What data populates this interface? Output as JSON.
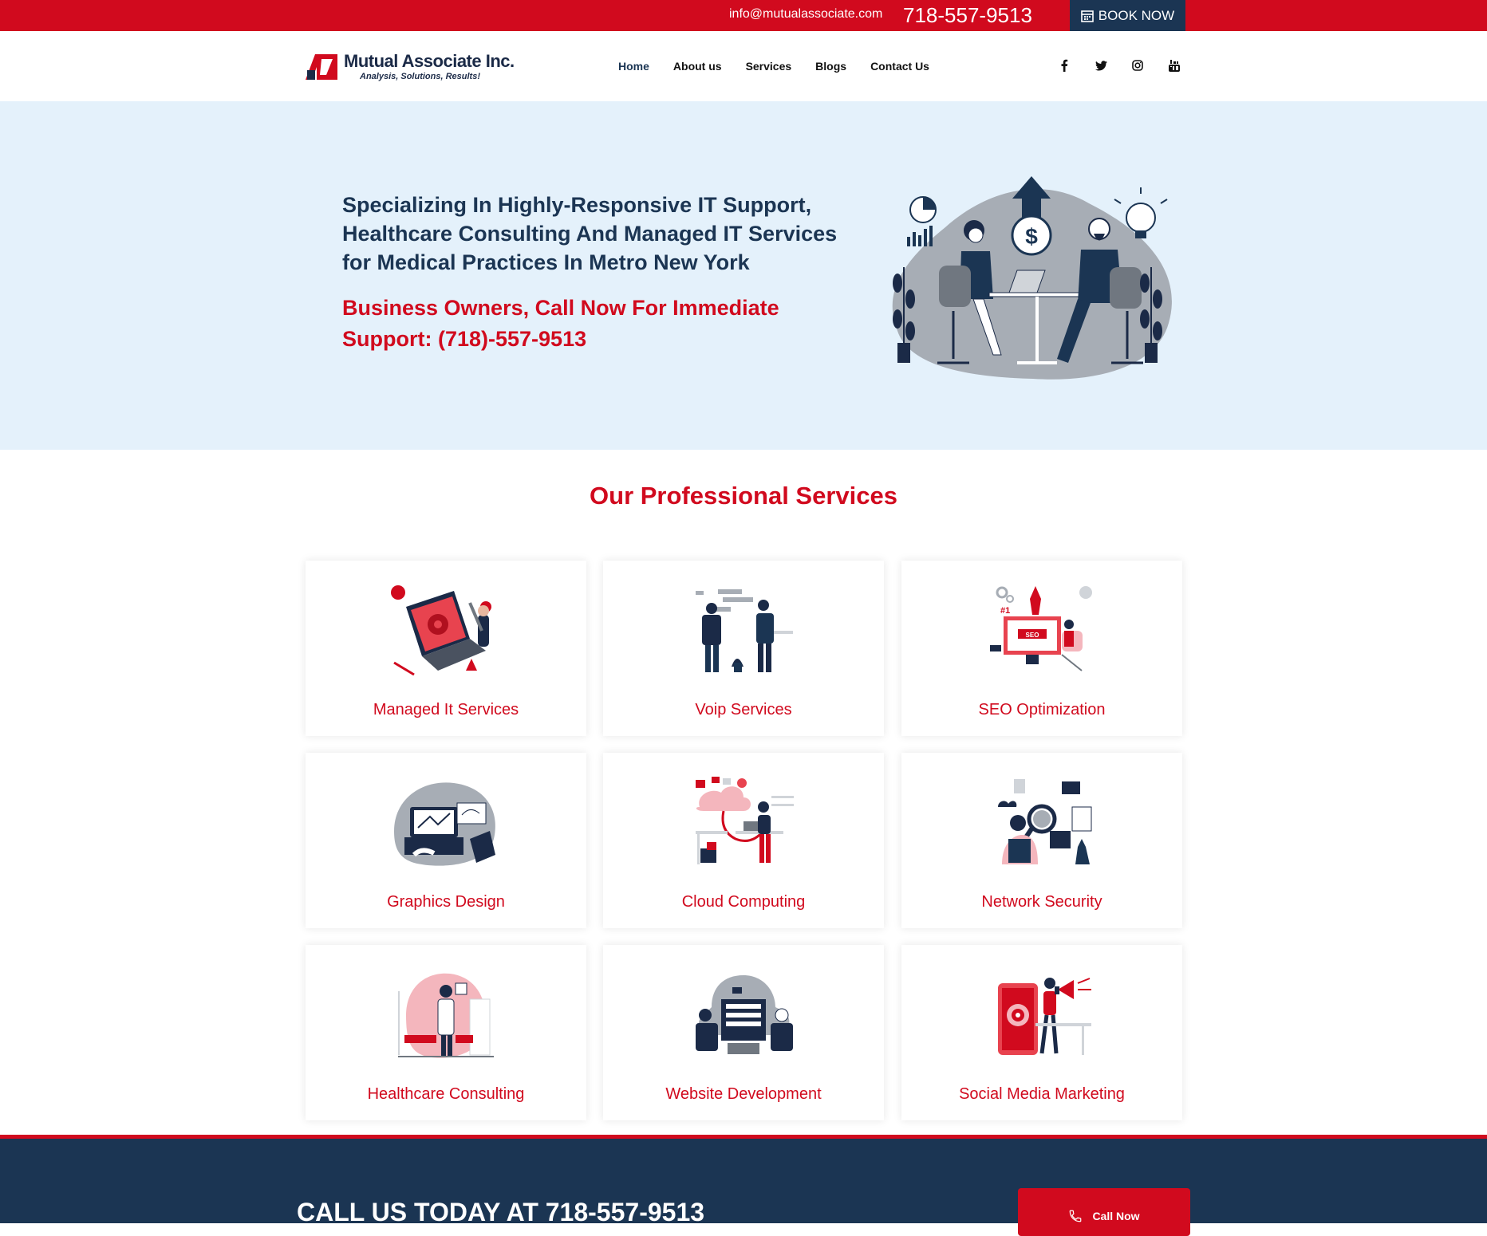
{
  "topbar": {
    "email": "info@mutualassociate.com",
    "phone": "718-557-9513",
    "book_label": "BOOK NOW"
  },
  "brand": {
    "name": "Mutual Associate Inc.",
    "tagline": "Analysis, Solutions, Results!"
  },
  "nav": {
    "items": [
      {
        "label": "Home",
        "active": true
      },
      {
        "label": "About us"
      },
      {
        "label": "Services"
      },
      {
        "label": "Blogs"
      },
      {
        "label": "Contact Us"
      }
    ]
  },
  "social": [
    "facebook-icon",
    "twitter-icon",
    "instagram-icon",
    "youtube-icon"
  ],
  "hero": {
    "heading": "Specializing In Highly-Responsive IT Support, Healthcare Consulting And Managed IT Services for Medical Practices In Metro New York",
    "subheading": "Business Owners, Call Now For Immediate Support: (718)-557-9513"
  },
  "services": {
    "title": "Our Professional Services",
    "items": [
      {
        "label": "Managed It Services"
      },
      {
        "label": "Voip Services"
      },
      {
        "label": "SEO Optimization"
      },
      {
        "label": "Graphics Design"
      },
      {
        "label": "Cloud Computing"
      },
      {
        "label": "Network Security"
      },
      {
        "label": "Healthcare Consulting"
      },
      {
        "label": "Website Development"
      },
      {
        "label": "Social Media Marketing"
      }
    ]
  },
  "cta": {
    "text": "CALL US TODAY AT 718-557-9513",
    "button_label": "Call Now"
  },
  "colors": {
    "brand_red": "#d10a1e",
    "brand_navy": "#1b3553",
    "hero_bg": "#e4f1fb"
  }
}
